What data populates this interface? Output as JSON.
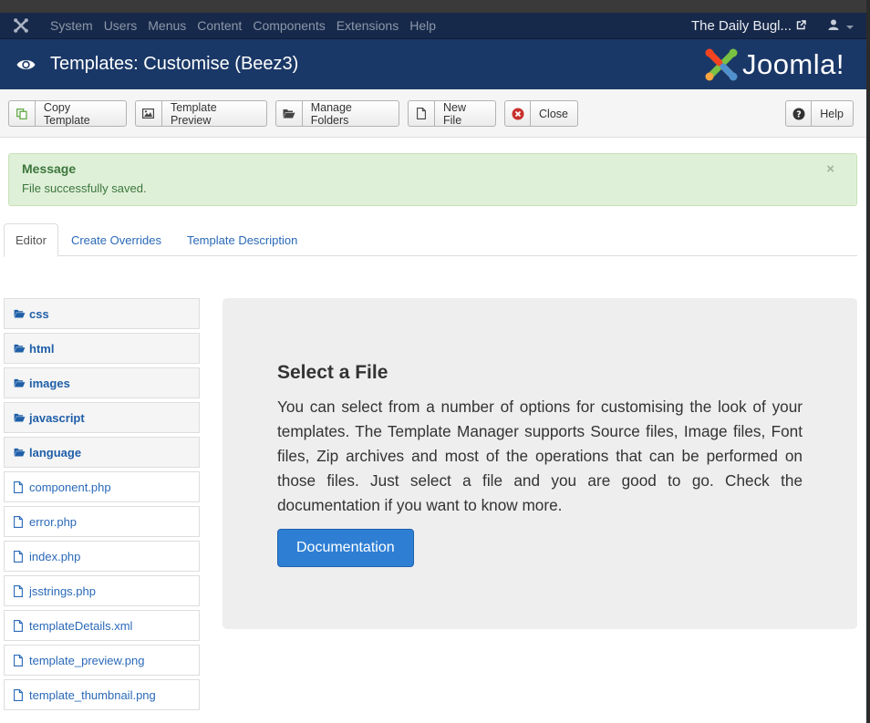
{
  "navbar": {
    "menu": [
      "System",
      "Users",
      "Menus",
      "Content",
      "Components",
      "Extensions",
      "Help"
    ],
    "site_name": "The Daily Bugl..."
  },
  "header": {
    "title": "Templates: Customise (Beez3)",
    "brand": "Joomla!"
  },
  "toolbar": {
    "copy_template": "Copy Template",
    "template_preview": "Template Preview",
    "manage_folders": "Manage Folders",
    "new_file": "New File",
    "close": "Close",
    "help": "Help"
  },
  "message": {
    "title": "Message",
    "body": "File successfully saved.",
    "close": "×"
  },
  "tabs": [
    "Editor",
    "Create Overrides",
    "Template Description"
  ],
  "tree": {
    "folders": [
      "css",
      "html",
      "images",
      "javascript",
      "language"
    ],
    "files": [
      "component.php",
      "error.php",
      "index.php",
      "jsstrings.php",
      "templateDetails.xml",
      "template_preview.png",
      "template_thumbnail.png"
    ]
  },
  "panel": {
    "heading": "Select a File",
    "text": "You can select from a number of options for customising the look of your templates. The Template Manager supports Source files, Image files, Font files, Zip archives and most of the operations that can be performed on those files. Just select a file and you are good to go. Check the documentation if you want to know more.",
    "button": "Documentation"
  },
  "colors": {
    "navbar_bg": "#17294a",
    "header_bg": "#1a3867",
    "link": "#2a69b8",
    "primary_button": "#2e7fd4",
    "success_bg": "#dff0d8"
  }
}
